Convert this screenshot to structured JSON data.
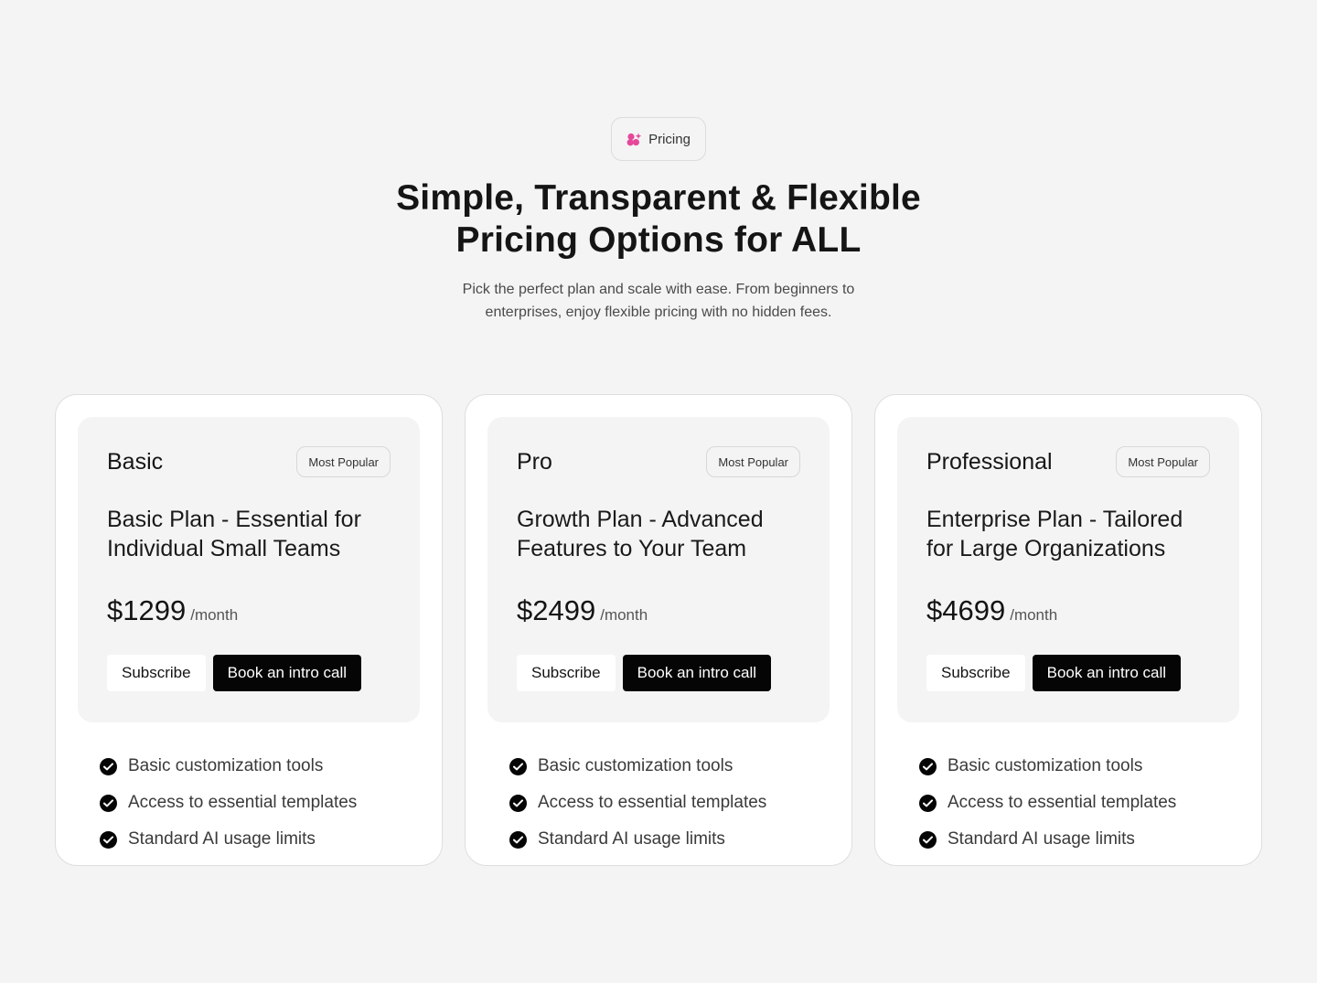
{
  "colors": {
    "background": "#f4f4f4",
    "card": "#ffffff",
    "accent_icon": "#e5489a",
    "dark_button": "#050505",
    "text": "#141414"
  },
  "hero": {
    "pill_icon": "sparkle-cluster-icon",
    "pill_label": "Pricing",
    "title_line1": "Simple, Transparent & Flexible",
    "title_line2": "Pricing Options for ALL",
    "subtitle": "Pick the perfect plan and scale with ease. From beginners to enterprises, enjoy flexible pricing with no hidden fees."
  },
  "plans": [
    {
      "name": "Basic",
      "badge": "Most Popular",
      "description": "Basic Plan - Essential for Individual Small Teams",
      "price": "$1299",
      "period": "/month",
      "subscribe_label": "Subscribe",
      "call_label": "Book an intro call",
      "features": [
        "Basic customization tools",
        "Access to essential templates",
        "Standard AI usage limits"
      ]
    },
    {
      "name": "Pro",
      "badge": "Most Popular",
      "description": "Growth Plan - Advanced Features to Your Team",
      "price": "$2499",
      "period": "/month",
      "subscribe_label": "Subscribe",
      "call_label": "Book an intro call",
      "features": [
        "Basic customization tools",
        "Access to essential templates",
        "Standard AI usage limits"
      ]
    },
    {
      "name": "Professional",
      "badge": "Most Popular",
      "description": "Enterprise Plan - Tailored for Large Organizations",
      "price": "$4699",
      "period": "/month",
      "subscribe_label": "Subscribe",
      "call_label": "Book an intro call",
      "features": [
        "Basic customization tools",
        "Access to essential templates",
        "Standard AI usage limits"
      ]
    }
  ]
}
